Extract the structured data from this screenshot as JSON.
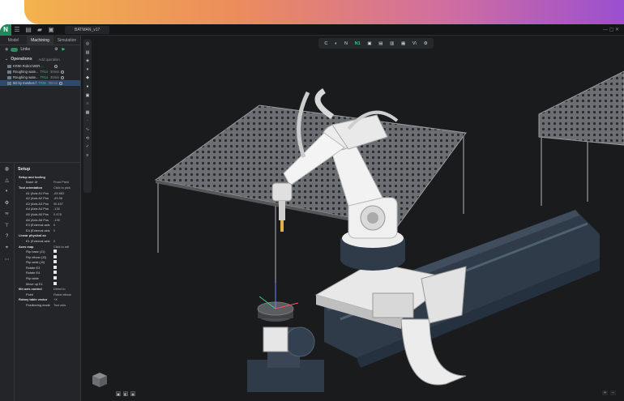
{
  "app": {
    "title": "BATMAN_v17",
    "logo": "N"
  },
  "tabs": [
    {
      "label": "Model"
    },
    {
      "label": "Machining"
    },
    {
      "label": "Simulation"
    }
  ],
  "links": {
    "label": "Links"
  },
  "operations": {
    "title": "Operations",
    "add_label": "Add operation",
    "items": [
      {
        "name": "KR90 Robot MER...",
        "tool": "",
        "time": ""
      },
      {
        "name": "Roughing wate...",
        "tool": "T#14",
        "time": "30min"
      },
      {
        "name": "Roughing wate...",
        "tool": "T#14",
        "time": "30min"
      },
      {
        "name": "5D by meshes f",
        "tool": "T#26",
        "time": "30min"
      }
    ]
  },
  "setup": {
    "title": "Setup",
    "setup_and_tooling": "Setup and tooling",
    "base_label": "Base: M",
    "base_value": "From Previ",
    "tool_orientation": {
      "label": "Tool orientation",
      "value": "Click to pick"
    },
    "axes": [
      {
        "label": "A1 (Axis A1 Pos",
        "value": "-89.683",
        "red": false
      },
      {
        "label": "A2 (Axis A2 Pos",
        "value": "-89.98",
        "red": false
      },
      {
        "label": "A3 (Axis A3 Pos",
        "value": "90.457",
        "red": false
      },
      {
        "label": "A4 (Axis A4 Pos",
        "value": "-135",
        "red": true
      },
      {
        "label": "A5 (Axis A5 Pos",
        "value": "0.478",
        "red": false
      },
      {
        "label": "A6 (Axis A6 Pos",
        "value": "-135",
        "red": true
      },
      {
        "label": "E3 (External axis",
        "value": "0",
        "red": false
      },
      {
        "label": "E4 (External axis",
        "value": "0",
        "red": false
      }
    ],
    "linear_physical": {
      "label": "Linear physical ax",
      "items": [
        {
          "label": "E1 (External axis",
          "value": "0"
        }
      ]
    },
    "axes_map": {
      "label": "Axes map",
      "value": "Click to edi",
      "items": [
        {
          "label": "Flip base (J1)"
        },
        {
          "label": "Flip elbow (J2)"
        },
        {
          "label": "Flip wrist (J4)"
        },
        {
          "label": "Rotate E3"
        },
        {
          "label": "Rotate E4"
        },
        {
          "label": "Flip table"
        },
        {
          "label": "Move up E1"
        }
      ]
    },
    "sixth_axis": {
      "label": "6th axis control",
      "value": "Direct to"
    },
    "point": {
      "label": "Point",
      "value": "Robot elbow"
    },
    "rotary": {
      "label": "Rotary table vector",
      "value": "+X"
    },
    "positioning": {
      "label": "Positioning mode",
      "value": "Tool axis"
    }
  },
  "toolbar": {
    "items": [
      "C",
      "◐",
      "N",
      "N1",
      "▣",
      "▤",
      "▥",
      "▦",
      "V\\",
      "⚙"
    ]
  },
  "colors": {
    "accent": "#2a8c63",
    "brand_gradient_start": "#f3b34d",
    "brand_gradient_end": "#9a4fd0",
    "selection": "#2f4b6b"
  }
}
